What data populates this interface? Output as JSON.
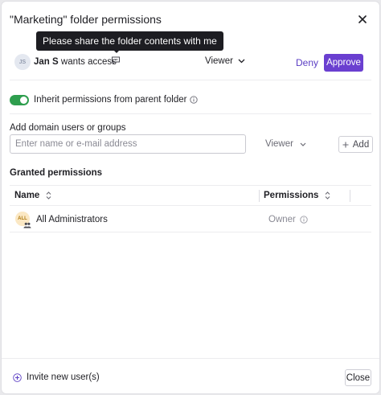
{
  "dialog": {
    "title": "\"Marketing\" folder permissions"
  },
  "tooltip": {
    "text": "Please share the folder contents with me"
  },
  "request": {
    "avatar_initials": "JS",
    "requester_name": "Jan S",
    "requester_action": " wants access",
    "role": "Viewer",
    "deny_label": "Deny",
    "approve_label": "Approve"
  },
  "inherit": {
    "label": "Inherit permissions from parent folder",
    "enabled": true
  },
  "add_users": {
    "label": "Add domain users or groups",
    "placeholder": "Enter name or e-mail address",
    "role": "Viewer",
    "add_label": "Add"
  },
  "granted": {
    "title": "Granted permissions",
    "columns": {
      "name": "Name",
      "permissions": "Permissions"
    },
    "rows": [
      {
        "avatar": "ALL",
        "name": "All Administrators",
        "permission": "Owner"
      }
    ]
  },
  "footer": {
    "invite_label": "Invite new user(s)",
    "close_label": "Close"
  },
  "colors": {
    "accent": "#6a3fd0",
    "toggle_on": "#2e9e4e",
    "tooltip_bg": "#1d1d22"
  }
}
